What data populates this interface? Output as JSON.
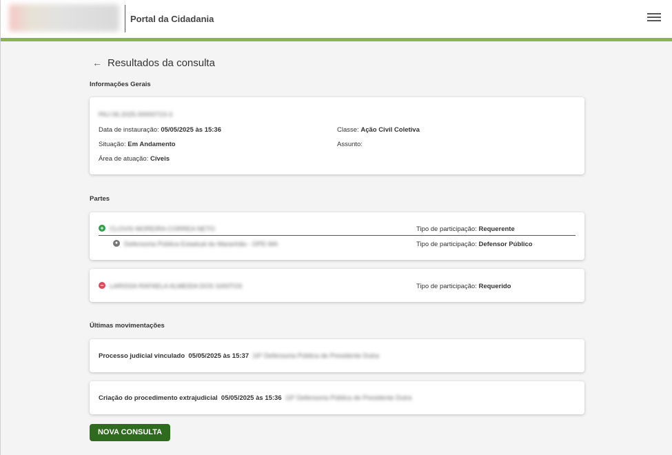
{
  "header": {
    "logo_alt": "logo",
    "portal_title": "Portal da Cidadania"
  },
  "page": {
    "back_icon": "←",
    "title": "Resultados da consulta"
  },
  "general_info": {
    "section_title": "Informações Gerais",
    "process_number": "PAJ 06.2025.00000723-3",
    "date_label": "Data de instauração:",
    "date_value": "05/05/2025 às 15:36",
    "class_label": "Classe:",
    "class_value": "Ação Civil Coletiva",
    "situation_label": "Situação:",
    "situation_value": "Em Andamento",
    "subject_label": "Assunto:",
    "subject_value": "",
    "area_label": "Área de atuação:",
    "area_value": "Cíveis"
  },
  "parties": {
    "section_title": "Partes",
    "items": [
      {
        "name": "CLOVIS MOREIRA CORREA NETO",
        "type_label": "Tipo de participação:",
        "type_value": "Requerente",
        "sub_name": "Defensoria Pública Estadual do Maranhão - DPE-MA",
        "sub_type_label": "Tipo de participação:",
        "sub_type_value": "Defensor Público"
      },
      {
        "name": "LARISSA RAFAELA ALMEIDA DOS SANTOS",
        "type_label": "Tipo de participação:",
        "type_value": "Requerido"
      }
    ]
  },
  "movements": {
    "section_title": "Últimas movimentações",
    "items": [
      {
        "title": "Processo judicial vinculado",
        "datetime": "05/05/2025 às 15:37",
        "office": "16º Defensoria Pública de Presidente Dutra"
      },
      {
        "title": "Criação do procedimento extrajudicial",
        "datetime": "05/05/2025 às 15:36",
        "office": "16º Defensoria Pública de Presidente Dutra"
      }
    ]
  },
  "actions": {
    "new_query_label": "NOVA CONSULTA"
  },
  "colors": {
    "accent_green": "#8bb34f",
    "button_green": "#2f6b1f",
    "plus_green": "#2e9d4a",
    "minus_red": "#e0485a"
  }
}
